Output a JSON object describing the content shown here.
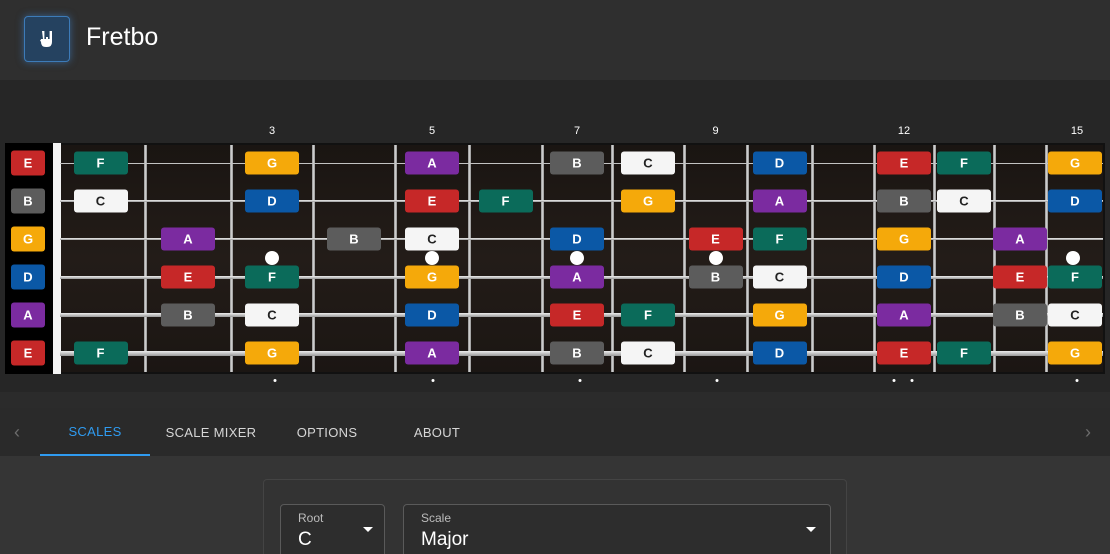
{
  "app": {
    "title": "Fretbo",
    "logo_icon": "rock-hand-icon"
  },
  "colors": {
    "E": "#c62828",
    "F": "#0b6b5a",
    "G": "#f5a90a",
    "A": "#7b2ba0",
    "B": "#5c5c5c",
    "C": "#f5f5f5",
    "D": "#0b58a6"
  },
  "fretboard": {
    "strings": [
      "E",
      "B",
      "G",
      "D",
      "A",
      "E"
    ],
    "fret_numbers": [
      {
        "fret": 3,
        "label": "3"
      },
      {
        "fret": 5,
        "label": "5"
      },
      {
        "fret": 7,
        "label": "7"
      },
      {
        "fret": 9,
        "label": "9"
      },
      {
        "fret": 12,
        "label": "12"
      },
      {
        "fret": 15,
        "label": "15"
      }
    ],
    "notes": [
      [
        "F",
        "",
        "G",
        "",
        "A",
        "",
        "B",
        "C",
        "",
        "D",
        "",
        "E",
        "F",
        "",
        "G"
      ],
      [
        "C",
        "",
        "D",
        "",
        "E",
        "F",
        "",
        "G",
        "",
        "A",
        "",
        "B",
        "C",
        "",
        "D"
      ],
      [
        "",
        "A",
        "",
        "B",
        "C",
        "",
        "D",
        "",
        "E",
        "F",
        "",
        "G",
        "",
        "A",
        ""
      ],
      [
        "",
        "E",
        "F",
        "",
        "G",
        "",
        "A",
        "",
        "B",
        "C",
        "",
        "D",
        "",
        "E",
        "F"
      ],
      [
        "",
        "B",
        "C",
        "",
        "D",
        "",
        "E",
        "F",
        "",
        "G",
        "",
        "A",
        "",
        "B",
        "C"
      ],
      [
        "F",
        "",
        "G",
        "",
        "A",
        "",
        "B",
        "C",
        "",
        "D",
        "",
        "E",
        "F",
        "",
        "G"
      ]
    ]
  },
  "tabs": {
    "items": [
      {
        "label": "SCALES",
        "active": true
      },
      {
        "label": "SCALE MIXER",
        "active": false
      },
      {
        "label": "OPTIONS",
        "active": false
      },
      {
        "label": "ABOUT",
        "active": false
      }
    ],
    "prev_icon": "chevron-left-icon",
    "next_icon": "chevron-right-icon"
  },
  "controls": {
    "root": {
      "label": "Root",
      "value": "C"
    },
    "scale": {
      "label": "Scale",
      "value": "Major"
    }
  }
}
